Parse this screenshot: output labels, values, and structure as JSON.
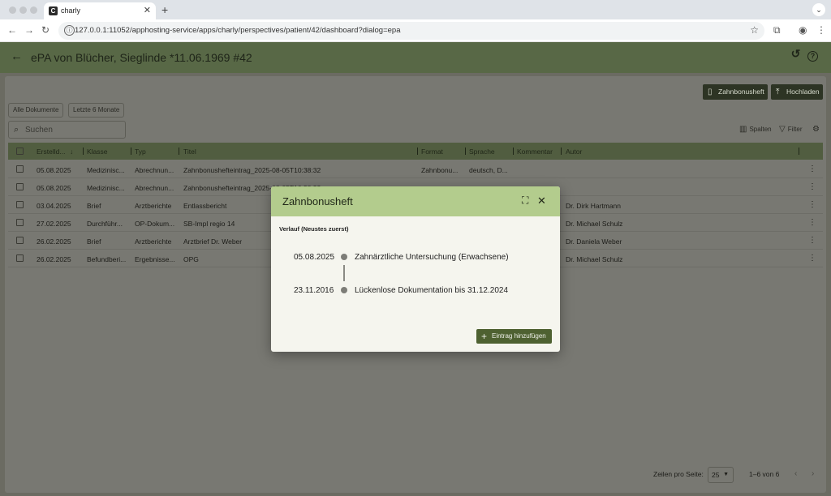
{
  "browser": {
    "tab_title": "charly",
    "tab_favicon": "C",
    "url": "127.0.0.1:11052/apphosting-service/apps/charly/perspectives/patient/42/dashboard?dialog=epa"
  },
  "header": {
    "title": "ePA von Blücher, Sieglinde *11.06.1969 #42"
  },
  "toolbar": {
    "zahnbonusheft_label": "Zahnbonusheft",
    "hochladen_label": "Hochladen",
    "chip_all": "Alle Dokumente",
    "chip_last6": "Letzte 6 Monate",
    "search_placeholder": "Suchen",
    "spalten_label": "Spalten",
    "filter_label": "Filter"
  },
  "table": {
    "columns": [
      "Erstelld...",
      "Klasse",
      "Typ",
      "Titel",
      "Format",
      "Sprache",
      "Kommentar",
      "Autor"
    ],
    "rows": [
      {
        "date": "05.08.2025",
        "klasse": "Medizinisc...",
        "typ": "Abrechnun...",
        "titel": "Zahnbonusheftеintrag_2025-08-05T10:38:32",
        "format": "Zahnbonu...",
        "sprache": "deutsch, D...",
        "kommentar": "",
        "autor": ""
      },
      {
        "date": "05.08.2025",
        "klasse": "Medizinisc...",
        "typ": "Abrechnun...",
        "titel": "Zahnbonusheftеintrag_2025-08-05T10:38:32",
        "format": "",
        "sprache": "",
        "kommentar": "",
        "autor": ""
      },
      {
        "date": "03.04.2025",
        "klasse": "Brief",
        "typ": "Arztberichte",
        "titel": "Entlassbericht",
        "format": "",
        "sprache": "",
        "kommentar": "",
        "autor": "Dr. Dirk Hartmann"
      },
      {
        "date": "27.02.2025",
        "klasse": "Durchführ...",
        "typ": "OP-Dokum...",
        "titel": "SB-Impl regio 14",
        "format": "",
        "sprache": "",
        "kommentar": "",
        "autor": "Dr. Michael Schulz"
      },
      {
        "date": "26.02.2025",
        "klasse": "Brief",
        "typ": "Arztberichte",
        "titel": "Arztbrief Dr. Weber",
        "format": "",
        "sprache": "",
        "kommentar": "",
        "autor": "Dr. Daniela Weber"
      },
      {
        "date": "26.02.2025",
        "klasse": "Befundberi...",
        "typ": "Ergebnisse...",
        "titel": "OPG",
        "format": "",
        "sprache": "",
        "kommentar": "",
        "autor": "Dr. Michael Schulz"
      }
    ]
  },
  "pagination": {
    "rows_label": "Zeilen pro Seite:",
    "rows_value": "25",
    "range": "1–6 von 6"
  },
  "dialog": {
    "title": "Zahnbonusheft",
    "section": "Verlauf (Neustes zuerst)",
    "entries": [
      {
        "date": "05.08.2025",
        "text": "Zahnärztliche Untersuchung (Erwachsene)"
      },
      {
        "date": "23.11.2016",
        "text": "Lückenlose Dokumentation bis 31.12.2024"
      }
    ],
    "add_label": "Eintrag hinzufügen"
  }
}
